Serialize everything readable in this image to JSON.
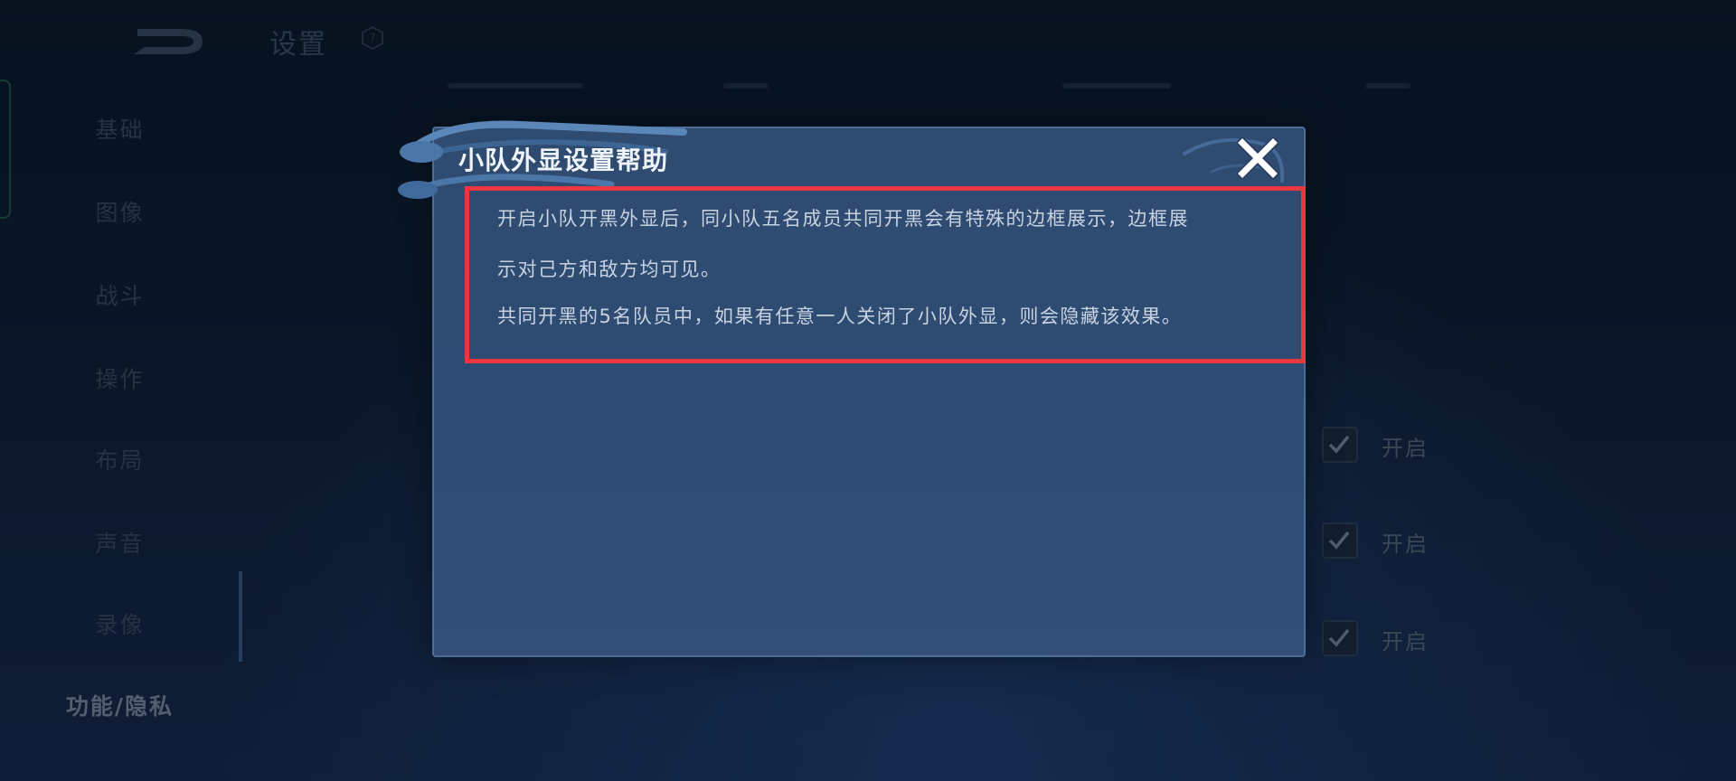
{
  "header": {
    "title": "设置"
  },
  "sidebar": {
    "items": [
      {
        "label": "基础"
      },
      {
        "label": "图像"
      },
      {
        "label": "战斗"
      },
      {
        "label": "操作"
      },
      {
        "label": "布局"
      },
      {
        "label": "声音"
      },
      {
        "label": "录像"
      },
      {
        "label": "功能/隐私"
      }
    ],
    "active_index": 7
  },
  "settings_rows": [
    {
      "label": "开启",
      "checked": true
    },
    {
      "label": "开启",
      "checked": true
    },
    {
      "label": "开启",
      "checked": true
    }
  ],
  "dialog": {
    "title": "小队外显设置帮助",
    "lines": [
      "开启小队开黑外显后，同小队五名成员共同开黑会有特殊的边框展示，边框展",
      "示对己方和敌方均可见。",
      "共同开黑的5名队员中，如果有任意一人关闭了小队外显，则会隐藏该效果。"
    ],
    "close_icon": "close-icon"
  },
  "colors": {
    "dialog_bg": "#2f4b70",
    "highlight_border": "#e8373f",
    "title_text": "#eef3fa"
  }
}
